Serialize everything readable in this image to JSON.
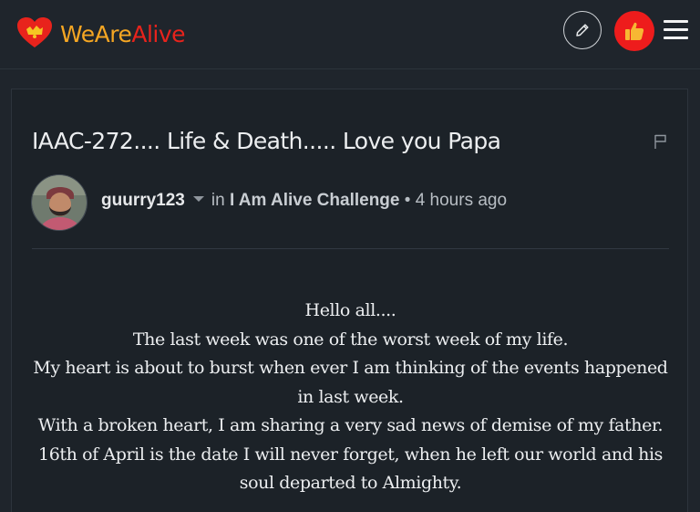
{
  "header": {
    "logo": {
      "icon": "heart-logo-icon",
      "text_we": "WeAre",
      "text_alive": "Alive",
      "color_we": "#f5a623",
      "color_alive": "#e8231c"
    },
    "actions": {
      "write_icon": "pencil-icon",
      "user_icon": "thumbs-up-icon",
      "user_avatar_color": "#ee1c1c",
      "menu_icon": "hamburger-menu-icon"
    }
  },
  "post": {
    "title": "IAAC-272.... Life & Death..... Love you Papa",
    "flag_icon": "flag-icon",
    "author": "guurry123",
    "in_label": "in",
    "community": "I Am Alive Challenge",
    "separator": "•",
    "time": "4 hours ago",
    "body": [
      "Hello all....",
      "The last week was one of the worst week of my life.",
      "My heart is about to burst when ever I am thinking of the events happened in last week.",
      "With a broken heart, I am sharing a very sad news of demise of my father.",
      "16th of April is the date I will never forget, when he left our world and his soul departed to Almighty."
    ]
  }
}
